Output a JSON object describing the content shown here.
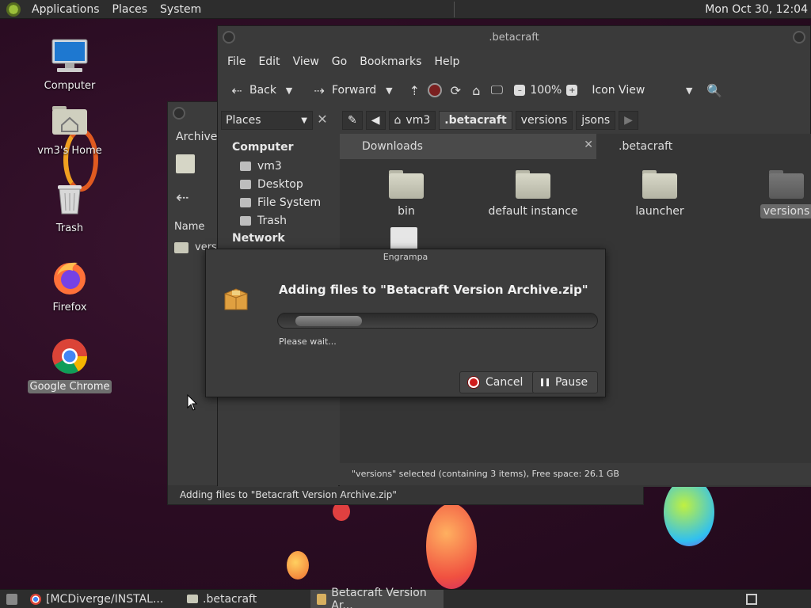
{
  "top_panel": {
    "menus": [
      "Applications",
      "Places",
      "System"
    ],
    "clock": "Mon Oct 30, 12:04"
  },
  "desktop_icons": [
    {
      "label": "Computer",
      "icon": "computer-icon"
    },
    {
      "label": "vm3's Home",
      "icon": "home-folder-icon"
    },
    {
      "label": "Trash",
      "icon": "trash-icon"
    },
    {
      "label": "Firefox",
      "icon": "firefox-icon"
    },
    {
      "label": "Google Chrome",
      "icon": "chrome-icon"
    }
  ],
  "archive_window": {
    "title": "Archive",
    "column_name": "Name",
    "row_label": "versi",
    "status": "Adding files to \"Betacraft Version Archive.zip\""
  },
  "file_manager": {
    "title": ".betacraft",
    "menu": [
      "File",
      "Edit",
      "View",
      "Go",
      "Bookmarks",
      "Help"
    ],
    "toolbar": {
      "back": "Back",
      "forward": "Forward",
      "zoom": "100%",
      "view_mode": "Icon View"
    },
    "places_selector": "Places",
    "breadcrumbs": [
      "vm3",
      ".betacraft",
      "versions",
      "jsons"
    ],
    "sidebar": {
      "computer_heading": "Computer",
      "computer_items": [
        "vm3",
        "Desktop",
        "File System",
        "Trash"
      ],
      "network_heading": "Network"
    },
    "tabs": [
      {
        "label": "Downloads",
        "active": false
      },
      {
        "label": ".betacraft",
        "active": true
      }
    ],
    "files": [
      {
        "name": "bin",
        "selected": false
      },
      {
        "name": "default instance",
        "selected": false
      },
      {
        "name": "launcher",
        "selected": false
      },
      {
        "name": "versions",
        "selected": true
      }
    ],
    "status": "\"versions\" selected (containing 3 items), Free space: 26.1 GB"
  },
  "dialog": {
    "title": "Engrampa",
    "heading": "Adding files to \"Betacraft Version Archive.zip\"",
    "message": "Please wait...",
    "cancel_label": "Cancel",
    "pause_label": "Pause"
  },
  "taskbar": {
    "items": [
      {
        "label": "[MCDiverge/INSTAL...",
        "active": false,
        "icon": "chrome-icon"
      },
      {
        "label": ".betacraft",
        "active": false,
        "icon": "folder-icon"
      },
      {
        "label": "Betacraft Version Ar...",
        "active": true,
        "icon": "archive-icon"
      }
    ]
  },
  "colors": {
    "accent_red": "#d01b1b",
    "panel_bg": "#2d2d2d",
    "window_bg": "#3b3b3b"
  }
}
